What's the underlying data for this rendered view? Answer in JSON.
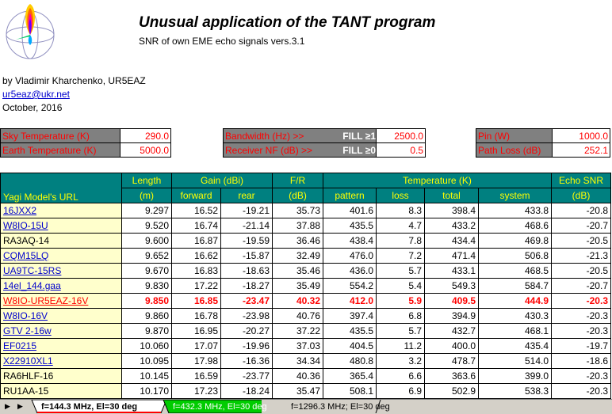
{
  "header": {
    "title": "Unusual application of  the TANT program",
    "subtitle": "SNR of own EME echo signals vers.3.1",
    "author": "by Vladimir Kharchenko, UR5EAZ",
    "email": "ur5eaz@ukr.net",
    "date": "October, 2016"
  },
  "params": {
    "sky_temp": {
      "label": "Sky Temperature (K)",
      "value": "290.0"
    },
    "earth_temp": {
      "label": "Earth Temperature (K)",
      "value": "5000.0"
    },
    "bandwidth": {
      "label": "Bandwidth (Hz) >>",
      "fill": "FILL ≥1",
      "value": "2500.0"
    },
    "receiver_nf": {
      "label": "Receiver NF (dB) >>",
      "fill": "FILL ≥0",
      "value": "0.5"
    },
    "pin": {
      "label": "Pin (W)",
      "value": "1000.0"
    },
    "path_loss": {
      "label": "Path Loss (dB)",
      "value": "252.1"
    }
  },
  "table": {
    "h_model": "Yagi Model's   URL",
    "h_length": "Length",
    "h_length_unit": "(m)",
    "h_gain": "Gain (dBi)",
    "h_forward": "forward",
    "h_rear": "rear",
    "h_fr": "F/R",
    "h_fr_unit": "(dB)",
    "h_temp": "Temperature (K)",
    "h_pattern": "pattern",
    "h_loss": "loss",
    "h_total": "total",
    "h_system": "system",
    "h_snr": "Echo SNR",
    "h_snr_unit": "(dB)",
    "rows": [
      {
        "name": "16JXX2",
        "link": true,
        "length": "9.297",
        "forward": "16.52",
        "rear": "-19.21",
        "fr": "35.73",
        "pattern": "401.6",
        "loss": "8.3",
        "total": "398.4",
        "system": "433.8",
        "snr": "-20.8"
      },
      {
        "name": "W8IO-15U",
        "link": true,
        "length": "9.520",
        "forward": "16.74",
        "rear": "-21.14",
        "fr": "37.88",
        "pattern": "435.5",
        "loss": "4.7",
        "total": "433.2",
        "system": "468.6",
        "snr": "-20.7"
      },
      {
        "name": "RA3AQ-14",
        "link": false,
        "length": "9.600",
        "forward": "16.87",
        "rear": "-19.59",
        "fr": "36.46",
        "pattern": "438.4",
        "loss": "7.8",
        "total": "434.4",
        "system": "469.8",
        "snr": "-20.5"
      },
      {
        "name": "CQM15LQ",
        "link": true,
        "length": "9.652",
        "forward": "16.62",
        "rear": "-15.87",
        "fr": "32.49",
        "pattern": "476.0",
        "loss": "7.2",
        "total": "471.4",
        "system": "506.8",
        "snr": "-21.3"
      },
      {
        "name": "UA9TC-15RS",
        "link": true,
        "length": "9.670",
        "forward": "16.83",
        "rear": "-18.63",
        "fr": "35.46",
        "pattern": "436.0",
        "loss": "5.7",
        "total": "433.1",
        "system": "468.5",
        "snr": "-20.5"
      },
      {
        "name": "14el_144.gaa",
        "link": true,
        "length": "9.830",
        "forward": "17.22",
        "rear": "-18.27",
        "fr": "35.49",
        "pattern": "554.2",
        "loss": "5.4",
        "total": "549.3",
        "system": "584.7",
        "snr": "-20.7"
      },
      {
        "name": "W8IO-UR5EAZ-16V",
        "link": true,
        "highlight": true,
        "length": "9.850",
        "forward": "16.85",
        "rear": "-23.47",
        "fr": "40.32",
        "pattern": "412.0",
        "loss": "5.9",
        "total": "409.5",
        "system": "444.9",
        "snr": "-20.3"
      },
      {
        "name": "W8IO-16V",
        "link": true,
        "length": "9.860",
        "forward": "16.78",
        "rear": "-23.98",
        "fr": "40.76",
        "pattern": "397.4",
        "loss": "6.8",
        "total": "394.9",
        "system": "430.3",
        "snr": "-20.3"
      },
      {
        "name": "GTV 2-16w",
        "link": true,
        "length": "9.870",
        "forward": "16.95",
        "rear": "-20.27",
        "fr": "37.22",
        "pattern": "435.5",
        "loss": "5.7",
        "total": "432.7",
        "system": "468.1",
        "snr": "-20.3"
      },
      {
        "name": "EF0215",
        "link": true,
        "length": "10.060",
        "forward": "17.07",
        "rear": "-19.96",
        "fr": "37.03",
        "pattern": "404.5",
        "loss": "11.2",
        "total": "400.0",
        "system": "435.4",
        "snr": "-19.7"
      },
      {
        "name": "X22910XL1",
        "link": true,
        "length": "10.095",
        "forward": "17.98",
        "rear": "-16.36",
        "fr": "34.34",
        "pattern": "480.8",
        "loss": "3.2",
        "total": "478.7",
        "system": "514.0",
        "snr": "-18.6"
      },
      {
        "name": "RA6HLF-16",
        "link": false,
        "length": "10.145",
        "forward": "16.59",
        "rear": "-23.77",
        "fr": "40.36",
        "pattern": "365.4",
        "loss": "6.6",
        "total": "363.6",
        "system": "399.0",
        "snr": "-20.3"
      },
      {
        "name": "RU1AA-15",
        "link": false,
        "length": "10.170",
        "forward": "17.23",
        "rear": "-18.24",
        "fr": "35.47",
        "pattern": "508.1",
        "loss": "6.9",
        "total": "502.9",
        "system": "538.3",
        "snr": "-20.3"
      }
    ]
  },
  "tabs": [
    {
      "label": "f=144.3 MHz, El=30 deg",
      "active": true
    },
    {
      "label": "f=432.3 MHz, El=30 deg",
      "active": false
    },
    {
      "label": "f=1296.3 MHz; El=30 deg",
      "active": false
    }
  ],
  "nav": {
    "prev": "▶",
    "next": "▶"
  },
  "icons": {
    "logo": "antenna-pattern-logo"
  },
  "colors": {
    "header_bg": "#008080",
    "header_text": "#ffff00",
    "model_bg": "#ffffcc",
    "param_label_bg": "#808080",
    "accent_red": "#ff0000",
    "active_tab_accent": "#ff0000",
    "tab2_bg": "#00cc00"
  }
}
